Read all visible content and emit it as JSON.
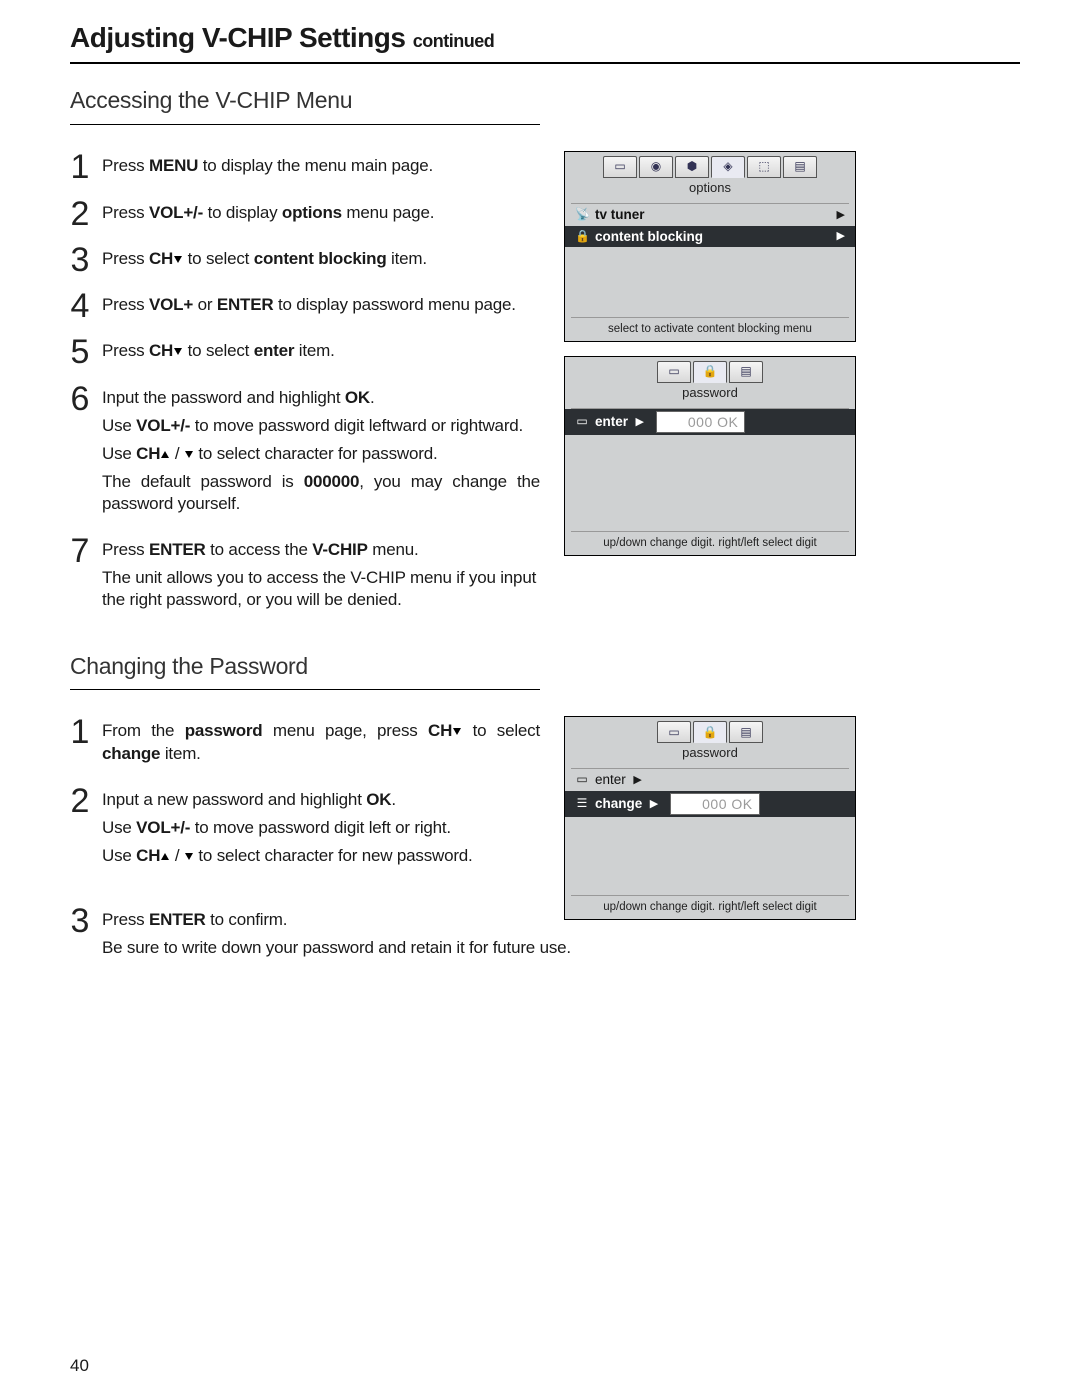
{
  "title_main": "Adjusting V-CHIP Settings ",
  "title_cont": "continued",
  "page_number": "40",
  "sec1": {
    "heading": "Accessing the V-CHIP Menu",
    "steps": {
      "s1a": "Press ",
      "s1b": "MENU",
      "s1c": " to display the menu main page.",
      "s2a": "Press ",
      "s2b": "VOL+/-",
      "s2c": " to display ",
      "s2d": "options",
      "s2e": " menu page.",
      "s3a": "Press ",
      "s3b": "CH",
      "s3c": " to select ",
      "s3d": "content blocking",
      "s3e": "  item.",
      "s4a": "Press ",
      "s4b": "VOL+",
      "s4c": " or ",
      "s4d": "ENTER",
      "s4e": " to display password menu page.",
      "s5a": "Press ",
      "s5b": "CH",
      "s5c": " to select  ",
      "s5d": "enter",
      "s5e": " item.",
      "s6a": "Input the password and highlight ",
      "s6b": "OK",
      "s6c": ".",
      "s6p2a": "Use ",
      "s6p2b": "VOL+/-",
      "s6p2c": " to move password digit leftward or rightward.",
      "s6p3a": "Use ",
      "s6p3b": "CH",
      "s6p3c": " / ",
      "s6p3d": " to select character for password.",
      "s6p4a": "The default password is ",
      "s6p4b": "000000",
      "s6p4c": ", you may change the password yourself.",
      "s7a": "Press ",
      "s7b": "ENTER",
      "s7c": " to access the ",
      "s7d": "V-CHIP",
      "s7e": " menu.",
      "s7p2": "The unit allows you to access the V-CHIP menu if you input the right password, or you will be denied."
    },
    "osd1": {
      "caption": "options",
      "row1": "tv tuner",
      "row2": "content blocking",
      "hint": "select to activate content blocking menu"
    },
    "osd2": {
      "caption": "password",
      "row1": "enter",
      "pw_dark": "000",
      "pw_grey": "000 OK",
      "hint": "up/down change digit. right/left select digit"
    }
  },
  "sec2": {
    "heading": "Changing the Password",
    "steps": {
      "s1a": "From the ",
      "s1b": "password",
      "s1c": " menu page, press ",
      "s1d": "CH",
      "s1e": " to select ",
      "s1f": "change",
      "s1g": " item.",
      "s2a": "Input a new password and highlight ",
      "s2b": "OK",
      "s2c": ".",
      "s2p2a": "Use ",
      "s2p2b": "VOL+/-",
      "s2p2c": " to move password digit left or right.",
      "s2p3a": "Use ",
      "s2p3b": "CH",
      "s2p3c": " / ",
      "s2p3d": " to select character for new password.",
      "s3a": "Press ",
      "s3b": "ENTER",
      "s3c": " to confirm.",
      "s3p2": "Be sure to write down your password and retain it for future use."
    },
    "osd": {
      "caption": "password",
      "row1": "enter",
      "row2": "change",
      "pw_dark": "000",
      "pw_grey": "000 OK",
      "hint": "up/down change digit. right/left select digit"
    }
  }
}
